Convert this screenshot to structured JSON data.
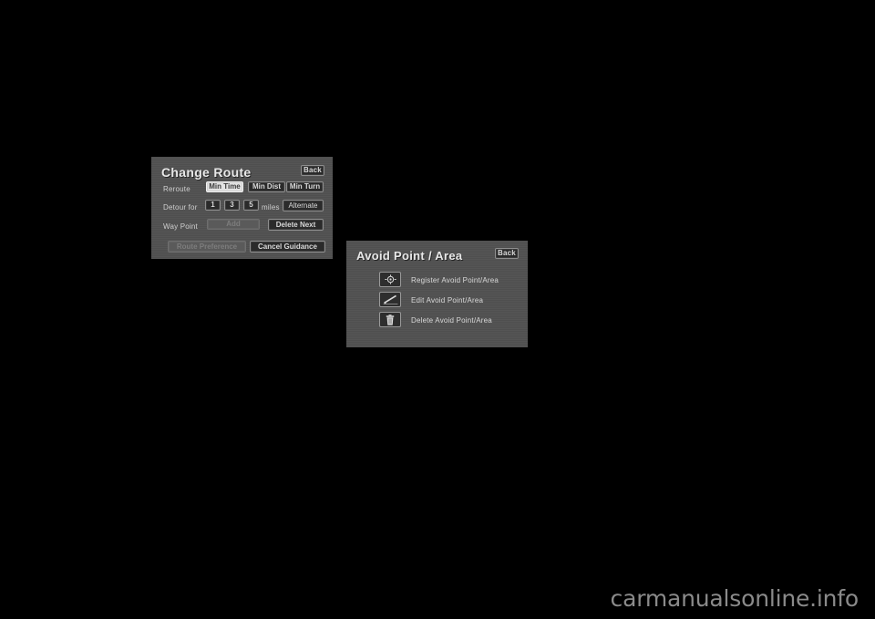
{
  "page": {
    "background_color": "#000000",
    "watermark": "carmanualsonline.info"
  },
  "panels": {
    "change_route": {
      "title": "Change Route",
      "back_label": "Back",
      "panel_color": "#515151",
      "rows": {
        "reroute": {
          "label": "Reroute",
          "options": [
            {
              "label": "Min Time",
              "state": "selected"
            },
            {
              "label": "Min Dist",
              "state": "normal"
            },
            {
              "label": "Min Turn",
              "state": "normal"
            }
          ]
        },
        "detour": {
          "label": "Detour for",
          "units": "miles",
          "options": [
            {
              "label": "1",
              "state": "normal"
            },
            {
              "label": "3",
              "state": "normal"
            },
            {
              "label": "5",
              "state": "normal"
            }
          ],
          "alternate_label": "Alternate"
        },
        "way_point": {
          "label": "Way Point",
          "add_label": "Add",
          "add_state": "disabled",
          "delete_next_label": "Delete Next",
          "delete_next_state": "normal"
        },
        "bottom": {
          "route_preference_label": "Route Preference",
          "route_preference_state": "disabled",
          "cancel_guidance_label": "Cancel Guidance",
          "cancel_guidance_state": "normal"
        }
      }
    },
    "avoid_point_area": {
      "title": "Avoid Point / Area",
      "back_label": "Back",
      "panel_color": "#515151",
      "items": [
        {
          "icon": "crosshair-target-icon",
          "label": "Register Avoid Point/Area"
        },
        {
          "icon": "pencil-edit-icon",
          "label": "Edit Avoid Point/Area"
        },
        {
          "icon": "trash-delete-icon",
          "label": "Delete Avoid Point/Area"
        }
      ]
    }
  }
}
